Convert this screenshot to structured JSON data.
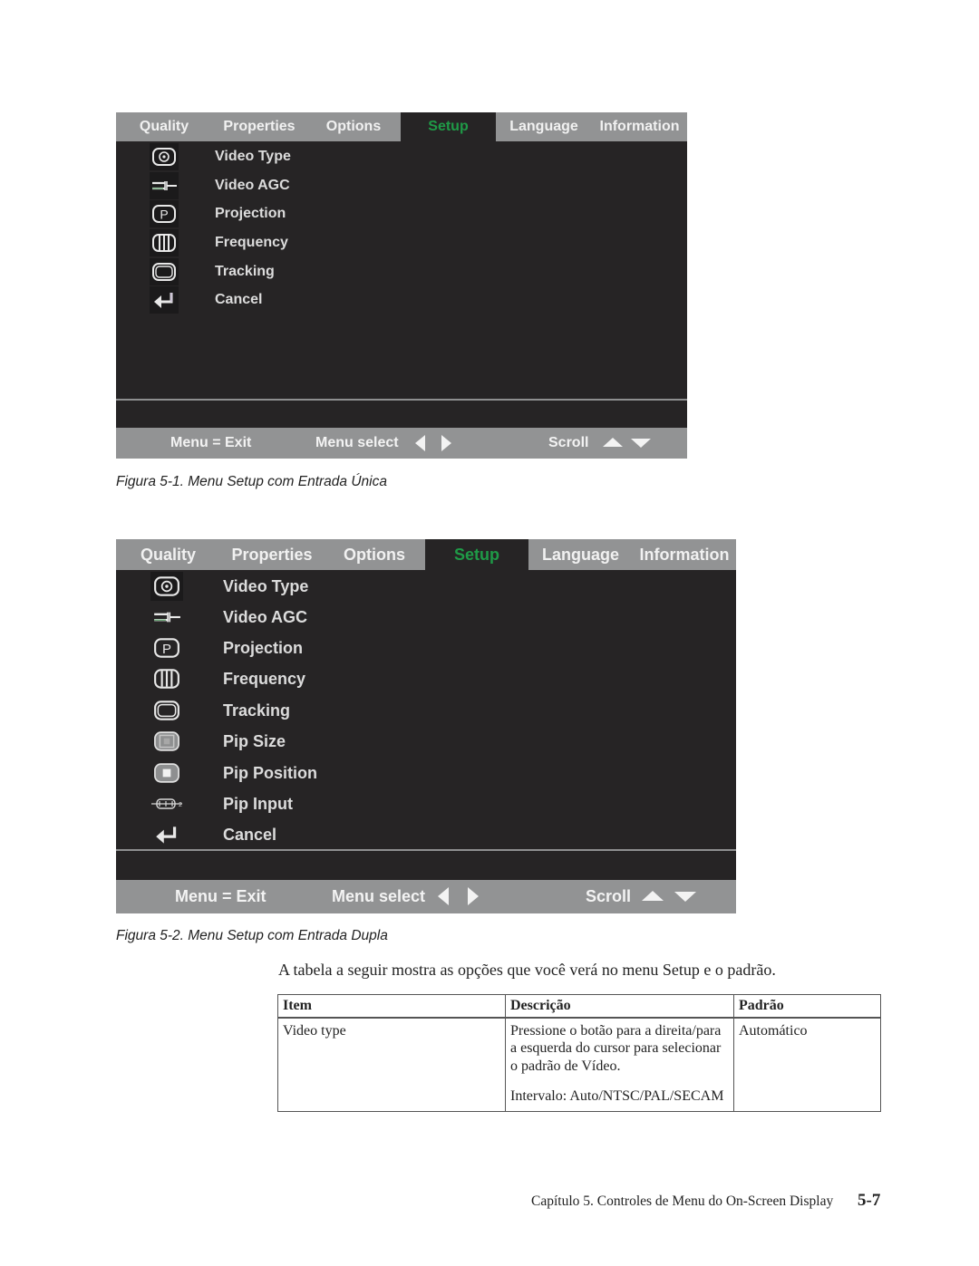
{
  "figures": [
    {
      "tabs": [
        {
          "label": "Quality",
          "active": false
        },
        {
          "label": "Properties",
          "active": false
        },
        {
          "label": "Options",
          "active": false
        },
        {
          "label": "Setup",
          "active": true
        },
        {
          "label": "Language",
          "active": false
        },
        {
          "label": "Information",
          "active": false
        }
      ],
      "items": [
        {
          "label": "Video Type",
          "icon": "video-type-icon"
        },
        {
          "label": "Video AGC",
          "icon": "video-agc-icon"
        },
        {
          "label": "Projection",
          "icon": "projection-icon"
        },
        {
          "label": "Frequency",
          "icon": "frequency-icon"
        },
        {
          "label": "Tracking",
          "icon": "tracking-icon"
        },
        {
          "label": "Cancel",
          "icon": "cancel-return-icon"
        }
      ],
      "footer": {
        "exit": "Menu = Exit",
        "select": "Menu select",
        "scroll": "Scroll"
      },
      "caption": "Figura 5-1. Menu Setup com Entrada Única"
    },
    {
      "tabs": [
        {
          "label": "Quality",
          "active": false
        },
        {
          "label": "Properties",
          "active": false
        },
        {
          "label": "Options",
          "active": false
        },
        {
          "label": "Setup",
          "active": true
        },
        {
          "label": "Language",
          "active": false
        },
        {
          "label": "Information",
          "active": false
        }
      ],
      "items": [
        {
          "label": "Video Type",
          "icon": "video-type-icon"
        },
        {
          "label": "Video AGC",
          "icon": "video-agc-icon"
        },
        {
          "label": "Projection",
          "icon": "projection-icon"
        },
        {
          "label": "Frequency",
          "icon": "frequency-icon"
        },
        {
          "label": "Tracking",
          "icon": "tracking-icon"
        },
        {
          "label": "Pip Size",
          "icon": "pip-size-icon"
        },
        {
          "label": "Pip Position",
          "icon": "pip-position-icon"
        },
        {
          "label": "Pip Input",
          "icon": "pip-input-icon"
        },
        {
          "label": "Cancel",
          "icon": "cancel-return-icon"
        }
      ],
      "footer": {
        "exit": "Menu = Exit",
        "select": "Menu select",
        "scroll": "Scroll"
      },
      "caption": "Figura 5-2. Menu Setup com Entrada Dupla"
    }
  ],
  "intro": "A tabela a seguir mostra as opções que você verá no menu Setup e o padrão.",
  "table": {
    "headers": [
      "Item",
      "Descrição",
      "Padrão"
    ],
    "rows": [
      {
        "item": "Video type",
        "description": "Pressione o botão para a direita/para a esquerda do cursor para selecionar o padrão de Vídeo.",
        "range": "Intervalo: Auto/NTSC/PAL/SECAM",
        "default": "Automático"
      }
    ]
  },
  "colors": {
    "osd_background": "#262425",
    "osd_bar": "#929394",
    "active_tab_text": "#1f9a47",
    "bar_text": "#f1f1f1"
  },
  "page_footer": {
    "running_title": "Capítulo 5. Controles de Menu do On-Screen Display",
    "page_number": "5-7"
  }
}
